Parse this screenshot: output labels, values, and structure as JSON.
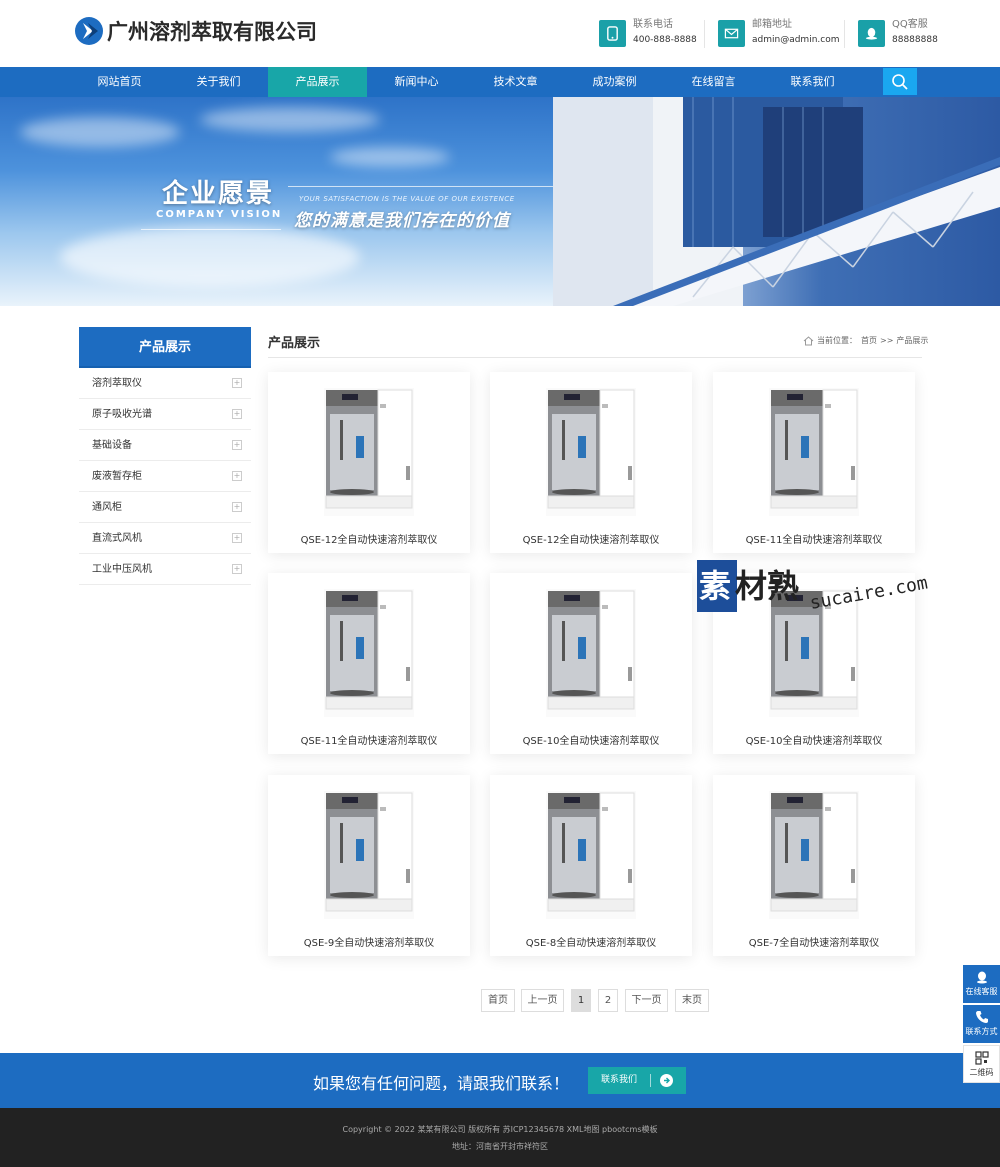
{
  "header": {
    "company_name": "广州溶剂萃取有限公司",
    "phone_label": "联系电话",
    "phone_value": "400-888-8888",
    "email_label": "邮箱地址",
    "email_value": "admin@admin.com",
    "qq_label": "QQ客服",
    "qq_value": "88888888"
  },
  "nav": {
    "items": [
      "网站首页",
      "关于我们",
      "产品展示",
      "新闻中心",
      "技术文章",
      "成功案例",
      "在线留言",
      "联系我们"
    ],
    "active": "产品展示"
  },
  "banner": {
    "title": "企业愿景",
    "title_en": "COMPANY VISION",
    "subtitle_en": "YOUR SATISFACTION IS THE VALUE OF OUR EXISTENCE",
    "subtitle": "您的满意是我们存在的价值"
  },
  "sidebar": {
    "heading": "产品展示",
    "items": [
      "溶剂萃取仪",
      "原子吸收光谱",
      "基础设备",
      "废液暂存柜",
      "通风柜",
      "直流式风机",
      "工业中压风机"
    ]
  },
  "content": {
    "title": "产品展示",
    "breadcrumb_prefix": "当前位置：",
    "breadcrumb_home": "首页",
    "breadcrumb_sep": ">>",
    "breadcrumb_current": "产品展示"
  },
  "products": [
    {
      "name": "QSE-12全自动快速溶剂萃取仪"
    },
    {
      "name": "QSE-12全自动快速溶剂萃取仪"
    },
    {
      "name": "QSE-11全自动快速溶剂萃取仪"
    },
    {
      "name": "QSE-11全自动快速溶剂萃取仪"
    },
    {
      "name": "QSE-10全自动快速溶剂萃取仪"
    },
    {
      "name": "QSE-10全自动快速溶剂萃取仪"
    },
    {
      "name": "QSE-9全自动快速溶剂萃取仪"
    },
    {
      "name": "QSE-8全自动快速溶剂萃取仪"
    },
    {
      "name": "QSE-7全自动快速溶剂萃取仪"
    }
  ],
  "pagination": {
    "first": "首页",
    "prev": "上一页",
    "pages": [
      "1",
      "2"
    ],
    "current": "1",
    "next": "下一页",
    "last": "末页"
  },
  "cta": {
    "text": "如果您有任何问题，请跟我们联系！",
    "button": "联系我们"
  },
  "footer": {
    "copyright": "Copyright © 2022 某某有限公司 版权所有 苏ICP12345678 XML地图 pbootcms模板",
    "address": "地址：河南省开封市祥符区"
  },
  "float_bar": {
    "online": "在线客服",
    "contact": "联系方式",
    "qrcode": "二维码"
  },
  "watermark": {
    "text_cn": "素材熟",
    "text_en": "sucaire.com"
  },
  "colors": {
    "primary": "#1d6cc1",
    "accent": "#18a6a8",
    "footer": "#222222"
  }
}
